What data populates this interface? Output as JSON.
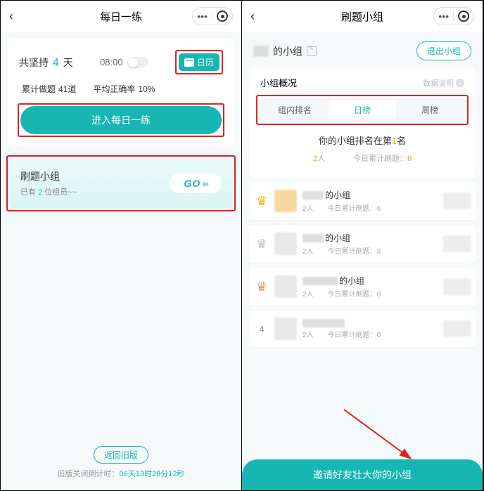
{
  "left": {
    "title": "每日一练",
    "persist_prefix": "共坚持",
    "persist_days": "4",
    "persist_suffix": "天",
    "alarm_time": "08:00",
    "calendar_label": "日历",
    "cumulative_label": "累计做题",
    "cumulative_value": "41道",
    "accuracy_label": "平均正确率",
    "accuracy_value": "10%",
    "enter_btn": "进入每日一练",
    "group_title": "刷题小组",
    "group_sub_prefix": "已有",
    "group_sub_count": "2",
    "group_sub_suffix": "位组员~~",
    "go_label": "GO",
    "back_old": "返回旧版",
    "countdown_prefix": "旧版关闭倒计时：",
    "countdown_value": "06天13时29分12秒"
  },
  "right": {
    "title": "刷题小组",
    "group_name_suffix": "的小组",
    "leave_btn": "退出小组",
    "overview_title": "小组概况",
    "data_desc": "数据说明",
    "tabs": {
      "inner": "组内排名",
      "daily": "日榜",
      "weekly": "周榜"
    },
    "rank_prefix": "你的小组排名在第",
    "rank_num": "1",
    "rank_suffix": "名",
    "people_label_suffix": "人",
    "today_label": "今日累计刷题：",
    "self": {
      "people": "2",
      "today": "6"
    },
    "items": [
      {
        "rank_type": "gold",
        "name_suffix": "的小组",
        "people": "2",
        "today": "6"
      },
      {
        "rank_type": "silver",
        "name_suffix": "的小组",
        "people": "2",
        "today": "3"
      },
      {
        "rank_type": "bronze",
        "name_suffix": "的小组",
        "people": "2",
        "today": "0"
      },
      {
        "rank_type": "num",
        "rank": "4",
        "name_suffix": "",
        "people": "2",
        "today": "0"
      }
    ],
    "invite_btn": "邀请好友壮大你的小组"
  }
}
